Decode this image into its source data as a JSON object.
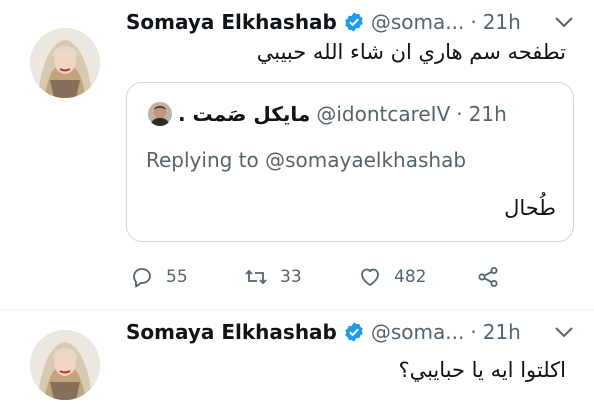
{
  "tweets": [
    {
      "author_name": "Somaya Elkhashab",
      "handle": "@soma...",
      "separator": "·",
      "time": "21h",
      "text": "تطفحه سم هاري ان شاء الله حبيبي",
      "quote": {
        "author_name": "مايكل صَمت .",
        "handle": "@idontcareIV",
        "separator": "·",
        "time": "21h",
        "reply_line": "Replying to @somayaelkhashab",
        "text": "طُحال"
      },
      "actions": {
        "reply_count": "55",
        "retweet_count": "33",
        "like_count": "482"
      }
    },
    {
      "author_name": "Somaya Elkhashab",
      "handle": "@soma...",
      "separator": "·",
      "time": "21h",
      "text": "اكلتوا ايه يا حبايبي؟"
    }
  ],
  "icons": {
    "verified": "verified-badge-icon",
    "more": "chevron-down-icon",
    "reply": "reply-icon",
    "retweet": "retweet-icon",
    "like": "heart-icon",
    "share": "share-icon"
  },
  "colors": {
    "verified_blue": "#1d9bf0",
    "secondary_text": "#536471",
    "border": "#cfd9de"
  }
}
